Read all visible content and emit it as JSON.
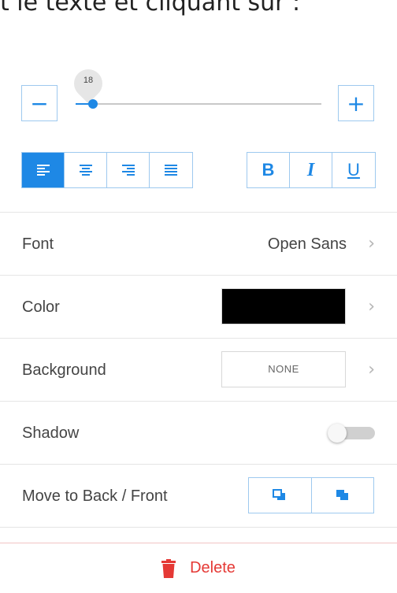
{
  "header": {
    "caption": "t le texte et cliquant sur :"
  },
  "size": {
    "value": "18",
    "min": 0,
    "max": 100,
    "fraction": 0.07,
    "minus_icon": "minus-icon",
    "plus_icon": "plus-icon"
  },
  "alignment": {
    "options": [
      "align-left",
      "align-center",
      "align-right",
      "align-justify"
    ],
    "active": "align-left"
  },
  "format": {
    "bold": "B",
    "italic": "I",
    "underline": "U"
  },
  "rows": {
    "font": {
      "label": "Font",
      "value": "Open Sans"
    },
    "color": {
      "label": "Color",
      "value": "#000000"
    },
    "background": {
      "label": "Background",
      "value": "NONE"
    },
    "shadow": {
      "label": "Shadow",
      "enabled": false
    },
    "order": {
      "label": "Move to Back / Front",
      "back_icon": "send-to-back-icon",
      "front_icon": "bring-to-front-icon"
    }
  },
  "delete": {
    "label": "Delete",
    "icon": "trash-icon"
  },
  "colors": {
    "accent": "#1e88e5",
    "danger": "#e53935",
    "swatch": "#000000"
  }
}
